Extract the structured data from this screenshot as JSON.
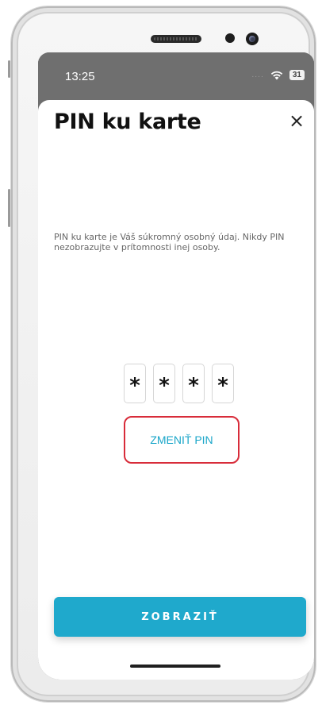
{
  "status_bar": {
    "time": "13:25",
    "signal_dots": "....",
    "wifi_icon": "wifi-icon",
    "battery": "31"
  },
  "dialog": {
    "title": "PIN ku karte",
    "close_icon": "close-icon",
    "close_glyph": "×",
    "info_text": "PIN ku karte je Váš súkromný osobný údaj. Nikdy PIN nezobrazujte v prítomnosti inej osoby.",
    "pin_digits": [
      "*",
      "*",
      "*",
      "*"
    ],
    "change_pin_label": "ZMENIŤ PIN",
    "show_button_label": "ZOBRAZIŤ"
  },
  "colors": {
    "accent": "#1fa9cc",
    "link": "#1aa6c9",
    "highlight_border": "#d82c3a",
    "status_bar": "#6f6f6f"
  }
}
